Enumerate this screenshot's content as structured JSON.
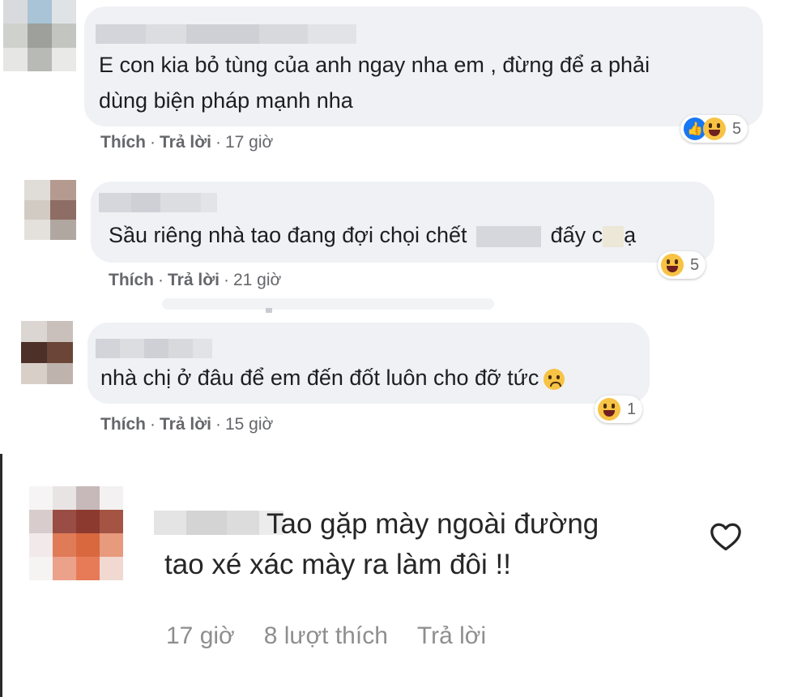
{
  "facebook_comments": [
    {
      "text_lines": [
        "E con kia bỏ tùng của anh ngay nha em , đừng để a phải",
        "dùng biện pháp mạnh nha"
      ],
      "actions": {
        "like": "Thích",
        "reply": "Trả lời",
        "time": "17 giờ"
      },
      "reactions": {
        "icons": [
          "like-icon",
          "haha-icon"
        ],
        "count": "5"
      }
    },
    {
      "text_parts": {
        "before": "Sầu riêng nhà tao đang đợi chọi chết",
        "middle": "đấy c",
        "end": "ạ"
      },
      "actions": {
        "like": "Thích",
        "reply": "Trả lời",
        "time": "21 giờ"
      },
      "reactions": {
        "icons": [
          "haha-icon"
        ],
        "count": "5"
      }
    },
    {
      "text": "nhà chị ở đâu để em đến đốt luôn cho đỡ tức",
      "actions": {
        "like": "Thích",
        "reply": "Trả lời",
        "time": "15 giờ"
      },
      "reactions": {
        "icons": [
          "haha-icon"
        ],
        "count": "1"
      }
    }
  ],
  "instagram_comment": {
    "text_lines": [
      "Tao gặp mày ngoài đường",
      "tao xé xác mày ra làm đôi !!"
    ],
    "time": "17 giờ",
    "likes": "8 lượt thích",
    "reply": "Trả lời",
    "like_icon": "heart-outline-icon"
  },
  "colors": {
    "bubble_bg": "#eff1f5",
    "meta_text": "#65676b",
    "ig_meta_text": "#8e8e8e",
    "like_blue": "#1877f2",
    "haha_yellow": "#f7c344"
  }
}
